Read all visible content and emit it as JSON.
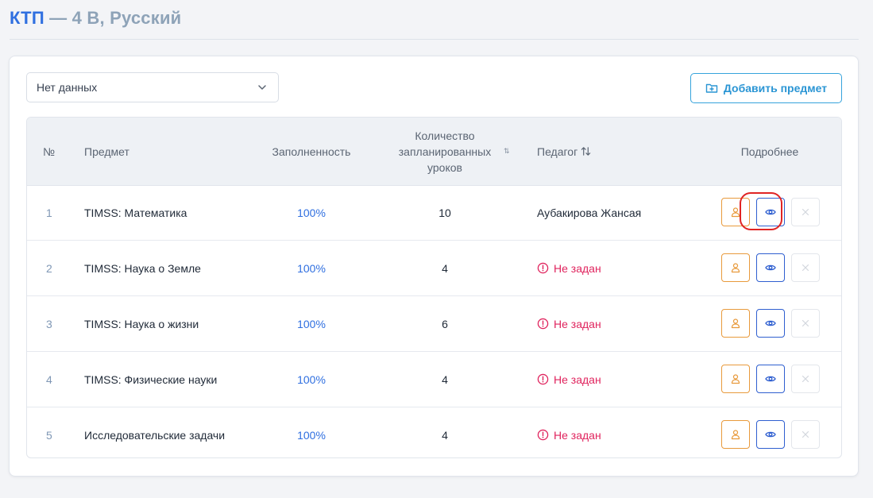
{
  "page": {
    "title_main": "КТП",
    "title_rest": "— 4 В, Русский"
  },
  "filter": {
    "selected": "Нет данных"
  },
  "toolbar": {
    "add_subject_label": "Добавить предмет"
  },
  "table": {
    "headers": {
      "num": "№",
      "subject": "Предмет",
      "fill": "Заполненность",
      "lessons_line1": "Количество",
      "lessons_line2": "запланированных",
      "lessons_line3": "уроков",
      "teacher": "Педагог",
      "details": "Подробнее"
    },
    "rows": [
      {
        "num": "1",
        "subject": "TIMSS: Математика",
        "fill": "100%",
        "lessons": "10",
        "teacher": "Аубакирова Жансая",
        "teacher_set": true
      },
      {
        "num": "2",
        "subject": "TIMSS: Наука о Земле",
        "fill": "100%",
        "lessons": "4",
        "teacher": "Не задан",
        "teacher_set": false
      },
      {
        "num": "3",
        "subject": "TIMSS: Наука о жизни",
        "fill": "100%",
        "lessons": "6",
        "teacher": "Не задан",
        "teacher_set": false
      },
      {
        "num": "4",
        "subject": "TIMSS: Физические науки",
        "fill": "100%",
        "lessons": "4",
        "teacher": "Не задан",
        "teacher_set": false
      },
      {
        "num": "5",
        "subject": "Исследовательские задачи",
        "fill": "100%",
        "lessons": "4",
        "teacher": "Не задан",
        "teacher_set": false
      }
    ]
  },
  "icons": {
    "user": "user-icon",
    "view": "eye-icon",
    "delete": "close-icon",
    "add": "folder-plus-icon",
    "sort": "sort-icon",
    "warning": "alert-circle-icon",
    "dropdown": "chevron-down-icon"
  },
  "colors": {
    "accent": "#2f6fe0",
    "title_muted": "#8ea3b8",
    "add_button": "#2a95d4",
    "user_button": "#e89a3c",
    "view_button": "#2f5fd0",
    "warning": "#e0245e",
    "highlight": "#e02424"
  }
}
